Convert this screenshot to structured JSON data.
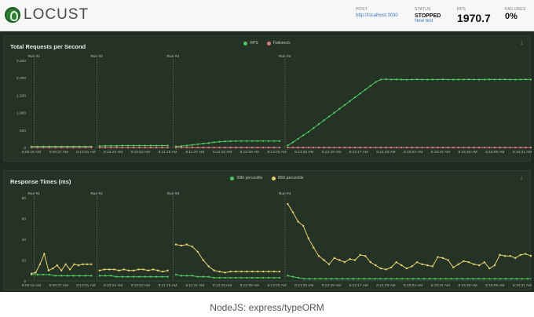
{
  "header": {
    "logo_text": "LOCUST",
    "host_label": "HOST",
    "host_value": "http://localhost:3030",
    "status_label": "STATUS",
    "status_value": "STOPPED",
    "new_test_label": "New test",
    "rps_label": "RPS",
    "rps_value": "1970.7",
    "failures_label": "FAILURES",
    "failures_value": "0%"
  },
  "colors": {
    "rps": "#4cc95a",
    "failures": "#e07a7a",
    "p50": "#4cc95a",
    "p95": "#e8d26b",
    "panel_bg": "#253226"
  },
  "caption": "NodeJS: express/typeORM",
  "chart_data": [
    {
      "type": "line",
      "title": "Total Requests per Second",
      "legend": [
        "RPS",
        "Failures/s"
      ],
      "legend_position": "top-center",
      "grid": false,
      "ylim": [
        0,
        2500
      ],
      "yticks": [
        "2,500",
        "2,000",
        "1,500",
        "1,000",
        "500",
        "0"
      ],
      "xticks": [
        "8:09:15 AM",
        "8:09:37 AM",
        "8:10:01 AM",
        "8:10:23 AM",
        "8:10:52 AM",
        "8:11:15 AM",
        "8:11:37 AM",
        "8:12:16 AM",
        "8:12:39 AM",
        "8:13:03 AM",
        "8:13:25 AM",
        "8:13:49 AM",
        "8:14:17 AM",
        "8:14:39 AM",
        "8:15:03 AM",
        "8:15:24 AM",
        "8:15:46 AM",
        "8:16:09 AM",
        "8:16:31 AM"
      ],
      "runs": [
        {
          "label": "Run #1",
          "x_index": 0.1
        },
        {
          "label": "Run #2",
          "x_index": 2.4
        },
        {
          "label": "Run #3",
          "x_index": 5.2
        },
        {
          "label": "Run #4",
          "x_index": 9.3
        }
      ],
      "series": [
        {
          "name": "RPS",
          "segments": [
            {
              "x": [
                0.0,
                2.2
              ],
              "values": [
                30,
                30,
                30,
                30,
                30,
                30,
                30,
                30,
                30,
                30,
                30
              ]
            },
            {
              "x": [
                2.5,
                5.0
              ],
              "values": [
                40,
                50,
                50,
                50,
                55,
                55,
                55,
                55,
                55,
                55,
                55,
                55,
                55
              ]
            },
            {
              "x": [
                5.3,
                9.1
              ],
              "values": [
                30,
                40,
                55,
                75,
                95,
                115,
                130,
                150,
                165,
                175,
                180,
                185,
                185,
                185,
                185,
                185,
                185,
                185,
                185,
                185
              ]
            },
            {
              "x": [
                9.4,
                24.2
              ],
              "values": [
                60,
                150,
                250,
                350,
                450,
                560,
                670,
                780,
                890,
                1000,
                1110,
                1220,
                1330,
                1440,
                1550,
                1660,
                1770,
                1880,
                1950,
                1960,
                1950,
                1955,
                1950,
                1945,
                1950,
                1955,
                1950,
                1948,
                1952,
                1950,
                1955,
                1950,
                1948,
                1950,
                1952,
                1955,
                1950,
                1948,
                1950,
                1955,
                1950,
                1952,
                1955,
                1950,
                1948,
                1950,
                1955,
                1952,
                1950,
                1955,
                1958,
                1950,
                1955,
                1960,
                1962,
                1958,
                1955,
                1960,
                1962,
                1965,
                1960,
                1958,
                1962,
                1960,
                1958,
                1965,
                1962,
                1960,
                1958,
                1960,
                1962,
                1960,
                1965,
                1962,
                1960,
                1958,
                1960,
                1962,
                1958
              ]
            }
          ]
        },
        {
          "name": "Failures/s",
          "segments": [
            {
              "x": [
                0.0,
                2.2
              ],
              "values": [
                0,
                0,
                0,
                0,
                0,
                0,
                0,
                0,
                0,
                0,
                0
              ]
            },
            {
              "x": [
                2.5,
                5.0
              ],
              "values": [
                0,
                0,
                0,
                0,
                0,
                0,
                0,
                0,
                0,
                0,
                0,
                0,
                0
              ]
            },
            {
              "x": [
                5.3,
                9.1
              ],
              "values": [
                0,
                0,
                0,
                0,
                0,
                0,
                0,
                0,
                0,
                0,
                0,
                0,
                0,
                0,
                0,
                0,
                0,
                0,
                0,
                0
              ]
            },
            {
              "x": [
                9.4,
                24.2
              ],
              "values": [
                0,
                0,
                0,
                0,
                0,
                0,
                0,
                0,
                0,
                0,
                0,
                0,
                0,
                0,
                0,
                0,
                0,
                0,
                0,
                0,
                0,
                0,
                0,
                0,
                0,
                0,
                0,
                0,
                0,
                0,
                0,
                0,
                0,
                0,
                0,
                0,
                0,
                0,
                0,
                0,
                0,
                0,
                0,
                0,
                0,
                0,
                0,
                0,
                0,
                0,
                0,
                0,
                0,
                0,
                0,
                0,
                0,
                0,
                0,
                0,
                0,
                0,
                0,
                0,
                0,
                0,
                0,
                0,
                0,
                0,
                0,
                0,
                0,
                0,
                0,
                0,
                0,
                0,
                0
              ]
            }
          ]
        }
      ]
    },
    {
      "type": "line",
      "title": "Response Times (ms)",
      "legend": [
        "50th percentile",
        "95th percentile"
      ],
      "legend_position": "top-center",
      "grid": false,
      "ylim": [
        0,
        80
      ],
      "yticks": [
        "80",
        "60",
        "40",
        "20",
        "0"
      ],
      "xticks": [
        "8:09:15 AM",
        "8:09:37 AM",
        "8:10:01 AM",
        "8:10:23 AM",
        "8:10:52 AM",
        "8:11:15 AM",
        "8:11:37 AM",
        "8:12:16 AM",
        "8:12:39 AM",
        "8:13:03 AM",
        "8:13:25 AM",
        "8:13:49 AM",
        "8:14:17 AM",
        "8:14:39 AM",
        "8:15:03 AM",
        "8:15:24 AM",
        "8:15:46 AM",
        "8:16:09 AM",
        "8:16:31 AM"
      ],
      "runs": [
        {
          "label": "Run #1",
          "x_index": 0.1
        },
        {
          "label": "Run #2",
          "x_index": 2.4
        },
        {
          "label": "Run #3",
          "x_index": 5.2
        },
        {
          "label": "Run #4",
          "x_index": 9.3
        }
      ],
      "series": [
        {
          "name": "50th percentile",
          "segments": [
            {
              "x": [
                0.0,
                2.2
              ],
              "values": [
                6,
                6,
                6,
                6,
                5,
                5,
                5,
                5,
                5,
                5,
                5
              ]
            },
            {
              "x": [
                2.5,
                5.0
              ],
              "values": [
                5,
                5,
                5,
                4,
                4,
                4,
                4,
                4,
                4,
                4,
                4,
                4,
                4
              ]
            },
            {
              "x": [
                5.3,
                9.1
              ],
              "values": [
                6,
                5,
                5,
                5,
                4,
                4,
                4,
                3,
                3,
                3,
                3,
                3,
                3,
                3,
                3,
                3,
                3,
                3,
                3,
                3
              ]
            },
            {
              "x": [
                9.4,
                24.2
              ],
              "values": [
                5,
                4,
                3,
                2,
                2,
                2,
                2,
                2,
                2,
                2,
                2,
                2,
                2,
                2,
                2,
                2,
                2,
                2,
                2,
                2,
                2,
                2,
                2,
                2,
                2,
                2,
                2,
                2,
                2,
                2,
                2,
                2,
                2,
                2,
                2,
                2,
                2,
                2,
                2,
                2,
                2,
                2,
                2,
                2,
                2,
                2,
                2,
                2,
                2,
                2,
                3,
                3,
                3,
                3,
                3,
                2,
                2,
                2,
                2,
                2,
                3,
                3,
                2,
                2,
                2,
                2,
                2,
                2,
                2,
                2,
                2,
                2,
                2,
                2,
                2
              ]
            }
          ]
        },
        {
          "name": "95th percentile",
          "segments": [
            {
              "x": [
                0.0,
                2.2
              ],
              "values": [
                7,
                8,
                16,
                26,
                10,
                12,
                15,
                10,
                16,
                11,
                16,
                15,
                16,
                16,
                16
              ]
            },
            {
              "x": [
                2.5,
                5.0
              ],
              "values": [
                10,
                11,
                11,
                11,
                10,
                11,
                10,
                10,
                11,
                11,
                10,
                11,
                10,
                9,
                10
              ]
            },
            {
              "x": [
                5.3,
                9.1
              ],
              "values": [
                35,
                34,
                35,
                33,
                28,
                20,
                14,
                10,
                9,
                8,
                9,
                9,
                9,
                9,
                9,
                9,
                9,
                9,
                9,
                9
              ]
            },
            {
              "x": [
                9.4,
                24.2
              ],
              "values": [
                74,
                66,
                57,
                53,
                41,
                32,
                24,
                20,
                16,
                22,
                20,
                18,
                21,
                20,
                25,
                24,
                18,
                15,
                12,
                11,
                13,
                18,
                15,
                12,
                14,
                18,
                16,
                15,
                14,
                23,
                22,
                20,
                13,
                16,
                19,
                18,
                16,
                15,
                18,
                12,
                15,
                25,
                24,
                24,
                22,
                25,
                26,
                24,
                30,
                47,
                56,
                56,
                22,
                30,
                26,
                28,
                26,
                27,
                28,
                24,
                22,
                27,
                30,
                27,
                24,
                16,
                20,
                19,
                22,
                21,
                16,
                18,
                12,
                14,
                14,
                13,
                15,
                16,
                16
              ]
            }
          ]
        }
      ]
    }
  ]
}
